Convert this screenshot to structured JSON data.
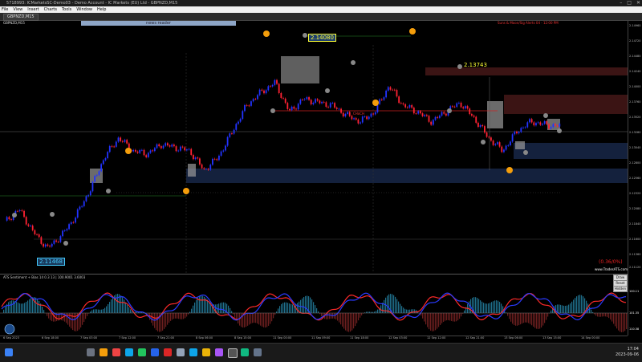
{
  "window": {
    "title": "5718993: ICMarketsSC-Demo03 - Demo Account - IC Markets (EU) Ltd - GBPNZD,M15",
    "min_label": "–",
    "max_label": "□",
    "close_label": "✕"
  },
  "menu": [
    "File",
    "View",
    "Insert",
    "Charts",
    "Tools",
    "Window",
    "Help"
  ],
  "tab": {
    "label": "GBPNZD,M15"
  },
  "chart_header": {
    "symbol_label": "GBPNZD,M15",
    "news_button": "news reader"
  },
  "price_labels": {
    "high_left": "2.14080",
    "mid_right": "2.13743",
    "low_left": "2.11468"
  },
  "annotations": {
    "choch": "CHoCH",
    "ratio": "(0.36/0%)",
    "site": "www.TradesATS.com",
    "top_info": "Suns & Moon/Sig Alerts 04 - 12:00 PM"
  },
  "side_buttons": [
    "Draw",
    "Reset",
    "Hidden"
  ],
  "indicator": {
    "title": "ATS Sentiment + Bias 14 0.3 13 | 100.9001 3.6003",
    "levels": [
      "100.11",
      "101.35",
      "110.38"
    ]
  },
  "price_axis": [
    "2.14960",
    "2.14720",
    "2.14480",
    "2.14240",
    "2.14000",
    "2.13760",
    "2.13520",
    "2.13280",
    "2.13040",
    "2.12800",
    "2.12560",
    "2.12320",
    "2.12080",
    "2.11840",
    "2.11600",
    "2.11360",
    "2.11120"
  ],
  "time_axis": [
    "6 Sep 2023",
    "6 Sep 18:00",
    "7 Sep 03:00",
    "7 Sep 12:00",
    "7 Sep 21:00",
    "8 Sep 06:00",
    "8 Sep 15:00",
    "11 Sep 00:00",
    "11 Sep 09:00",
    "11 Sep 18:00",
    "12 Sep 03:00",
    "12 Sep 12:00",
    "12 Sep 21:00",
    "13 Sep 06:00",
    "13 Sep 15:00",
    "14 Sep 00:00"
  ],
  "clock": {
    "time": "17:04",
    "date": "2023-09-06"
  },
  "colors": {
    "bull": "#2233ff",
    "bear": "#ff2233",
    "zone": "#14213d",
    "supply": "#3b1414"
  },
  "chart_data": {
    "type": "line",
    "close": [
      2.119,
      2.121,
      2.1175,
      2.115,
      2.117,
      2.12,
      2.124,
      2.129,
      2.132,
      2.13,
      2.1295,
      2.131,
      2.1305,
      2.13,
      2.127,
      2.129,
      2.133,
      2.137,
      2.139,
      2.1405,
      2.136,
      2.138,
      2.1375,
      2.137,
      2.1355,
      2.1345,
      2.136,
      2.14,
      2.137,
      2.136,
      2.1345,
      2.136,
      2.1374,
      2.135,
      2.132,
      2.13,
      2.133,
      2.1345,
      2.134,
      2.1338
    ]
  }
}
